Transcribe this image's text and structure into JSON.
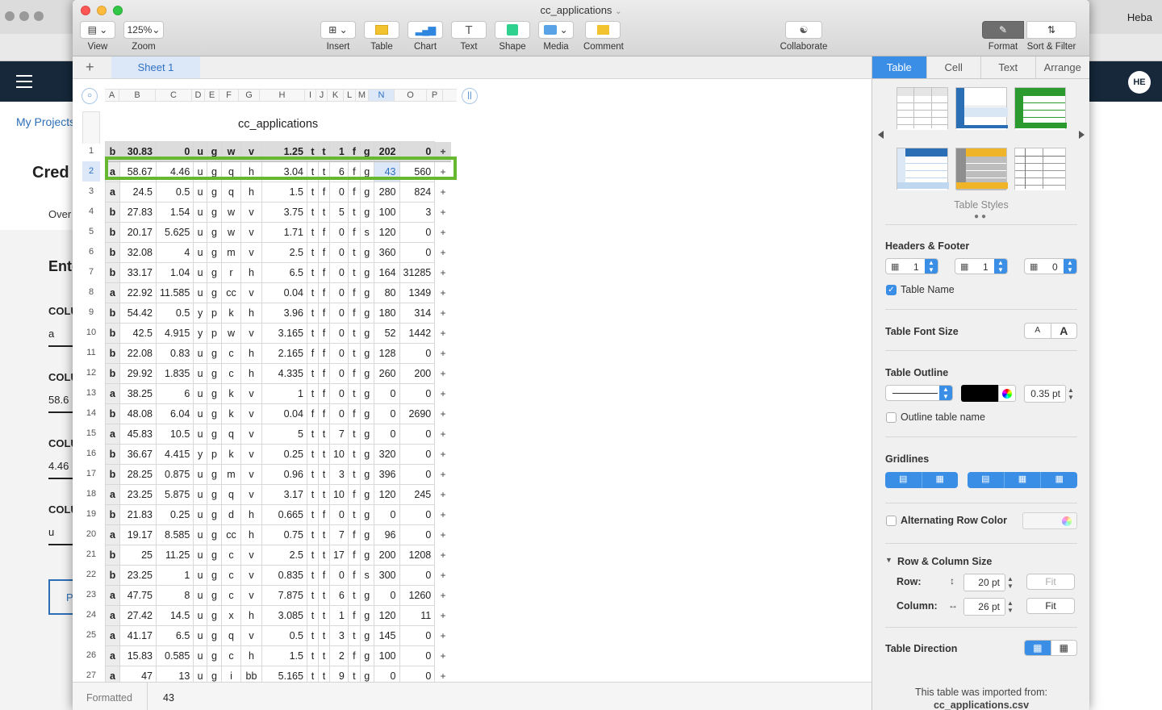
{
  "background": {
    "user_name": "Heba",
    "my_projects": "My Projects",
    "page_heading": "Cred",
    "overview_tab": "Over",
    "section_heading": "Ente",
    "columns": [
      {
        "label": "COLU",
        "value": "a"
      },
      {
        "label": "COLU",
        "value": "58.6"
      },
      {
        "label": "COLU",
        "value": "4.46"
      },
      {
        "label": "COLU",
        "value": "u"
      }
    ],
    "button_fragment": "P",
    "avatar": "HE"
  },
  "window": {
    "title": "cc_applications"
  },
  "toolbar": {
    "view": "View",
    "zoom_value": "125%",
    "zoom": "Zoom",
    "insert": "Insert",
    "table": "Table",
    "chart": "Chart",
    "text": "Text",
    "shape": "Shape",
    "media": "Media",
    "comment": "Comment",
    "collaborate": "Collaborate",
    "format": "Format",
    "sort_filter": "Sort & Filter"
  },
  "sheet": {
    "add": "+",
    "tab": "Sheet 1"
  },
  "table": {
    "name": "cc_applications",
    "column_letters": [
      "A",
      "B",
      "C",
      "D",
      "E",
      "F",
      "G",
      "H",
      "I",
      "J",
      "K",
      "L",
      "M",
      "N",
      "O",
      "P"
    ],
    "selected_column": "N",
    "selected_row": 2,
    "header": [
      "b",
      "30.83",
      "0",
      "u",
      "g",
      "w",
      "v",
      "1.25",
      "t",
      "t",
      "1",
      "f",
      "g",
      "202",
      "0"
    ],
    "rows": [
      [
        "a",
        "58.67",
        "4.46",
        "u",
        "g",
        "q",
        "h",
        "3.04",
        "t",
        "t",
        "6",
        "f",
        "g",
        "43",
        "560"
      ],
      [
        "a",
        "24.5",
        "0.5",
        "u",
        "g",
        "q",
        "h",
        "1.5",
        "t",
        "f",
        "0",
        "f",
        "g",
        "280",
        "824"
      ],
      [
        "b",
        "27.83",
        "1.54",
        "u",
        "g",
        "w",
        "v",
        "3.75",
        "t",
        "t",
        "5",
        "t",
        "g",
        "100",
        "3"
      ],
      [
        "b",
        "20.17",
        "5.625",
        "u",
        "g",
        "w",
        "v",
        "1.71",
        "t",
        "f",
        "0",
        "f",
        "s",
        "120",
        "0"
      ],
      [
        "b",
        "32.08",
        "4",
        "u",
        "g",
        "m",
        "v",
        "2.5",
        "t",
        "f",
        "0",
        "t",
        "g",
        "360",
        "0"
      ],
      [
        "b",
        "33.17",
        "1.04",
        "u",
        "g",
        "r",
        "h",
        "6.5",
        "t",
        "f",
        "0",
        "t",
        "g",
        "164",
        "31285"
      ],
      [
        "a",
        "22.92",
        "11.585",
        "u",
        "g",
        "cc",
        "v",
        "0.04",
        "t",
        "f",
        "0",
        "f",
        "g",
        "80",
        "1349"
      ],
      [
        "b",
        "54.42",
        "0.5",
        "y",
        "p",
        "k",
        "h",
        "3.96",
        "t",
        "f",
        "0",
        "f",
        "g",
        "180",
        "314"
      ],
      [
        "b",
        "42.5",
        "4.915",
        "y",
        "p",
        "w",
        "v",
        "3.165",
        "t",
        "f",
        "0",
        "t",
        "g",
        "52",
        "1442"
      ],
      [
        "b",
        "22.08",
        "0.83",
        "u",
        "g",
        "c",
        "h",
        "2.165",
        "f",
        "f",
        "0",
        "t",
        "g",
        "128",
        "0"
      ],
      [
        "b",
        "29.92",
        "1.835",
        "u",
        "g",
        "c",
        "h",
        "4.335",
        "t",
        "f",
        "0",
        "f",
        "g",
        "260",
        "200"
      ],
      [
        "a",
        "38.25",
        "6",
        "u",
        "g",
        "k",
        "v",
        "1",
        "t",
        "f",
        "0",
        "t",
        "g",
        "0",
        "0"
      ],
      [
        "b",
        "48.08",
        "6.04",
        "u",
        "g",
        "k",
        "v",
        "0.04",
        "f",
        "f",
        "0",
        "f",
        "g",
        "0",
        "2690"
      ],
      [
        "a",
        "45.83",
        "10.5",
        "u",
        "g",
        "q",
        "v",
        "5",
        "t",
        "t",
        "7",
        "t",
        "g",
        "0",
        "0"
      ],
      [
        "b",
        "36.67",
        "4.415",
        "y",
        "p",
        "k",
        "v",
        "0.25",
        "t",
        "t",
        "10",
        "t",
        "g",
        "320",
        "0"
      ],
      [
        "b",
        "28.25",
        "0.875",
        "u",
        "g",
        "m",
        "v",
        "0.96",
        "t",
        "t",
        "3",
        "t",
        "g",
        "396",
        "0"
      ],
      [
        "a",
        "23.25",
        "5.875",
        "u",
        "g",
        "q",
        "v",
        "3.17",
        "t",
        "t",
        "10",
        "f",
        "g",
        "120",
        "245"
      ],
      [
        "b",
        "21.83",
        "0.25",
        "u",
        "g",
        "d",
        "h",
        "0.665",
        "t",
        "f",
        "0",
        "t",
        "g",
        "0",
        "0"
      ],
      [
        "a",
        "19.17",
        "8.585",
        "u",
        "g",
        "cc",
        "h",
        "0.75",
        "t",
        "t",
        "7",
        "f",
        "g",
        "96",
        "0"
      ],
      [
        "b",
        "25",
        "11.25",
        "u",
        "g",
        "c",
        "v",
        "2.5",
        "t",
        "t",
        "17",
        "f",
        "g",
        "200",
        "1208"
      ],
      [
        "b",
        "23.25",
        "1",
        "u",
        "g",
        "c",
        "v",
        "0.835",
        "t",
        "f",
        "0",
        "f",
        "s",
        "300",
        "0"
      ],
      [
        "a",
        "47.75",
        "8",
        "u",
        "g",
        "c",
        "v",
        "7.875",
        "t",
        "t",
        "6",
        "t",
        "g",
        "0",
        "1260"
      ],
      [
        "a",
        "27.42",
        "14.5",
        "u",
        "g",
        "x",
        "h",
        "3.085",
        "t",
        "t",
        "1",
        "f",
        "g",
        "120",
        "11"
      ],
      [
        "a",
        "41.17",
        "6.5",
        "u",
        "g",
        "q",
        "v",
        "0.5",
        "t",
        "t",
        "3",
        "t",
        "g",
        "145",
        "0"
      ],
      [
        "a",
        "15.83",
        "0.585",
        "u",
        "g",
        "c",
        "h",
        "1.5",
        "t",
        "t",
        "2",
        "f",
        "g",
        "100",
        "0"
      ],
      [
        "a",
        "47",
        "13",
        "u",
        "g",
        "i",
        "bb",
        "5.165",
        "t",
        "t",
        "9",
        "t",
        "g",
        "0",
        "0"
      ]
    ],
    "add_column": "+"
  },
  "status": {
    "label": "Formatted",
    "value": "43"
  },
  "inspector": {
    "tabs": [
      "Table",
      "Cell",
      "Text",
      "Arrange"
    ],
    "active_tab": "Table",
    "table_styles_label": "Table Styles",
    "headers_footer": "Headers & Footer",
    "header_rows": "1",
    "header_cols": "1",
    "footer_rows": "0",
    "table_name_label": "Table Name",
    "table_font_size": "Table Font Size",
    "font_small": "A",
    "font_large": "A",
    "table_outline": "Table Outline",
    "outline_width": "0.35 pt",
    "outline_name_label": "Outline table name",
    "gridlines": "Gridlines",
    "alternating": "Alternating Row Color",
    "row_col_size": "Row & Column Size",
    "row_label": "Row:",
    "row_value": "20 pt",
    "col_label": "Column:",
    "col_value": "26 pt",
    "fit": "Fit",
    "table_direction": "Table Direction",
    "import_note_1": "This table was imported from:",
    "import_note_2": "cc_applications.csv",
    "accent": "#3a8ee6"
  }
}
